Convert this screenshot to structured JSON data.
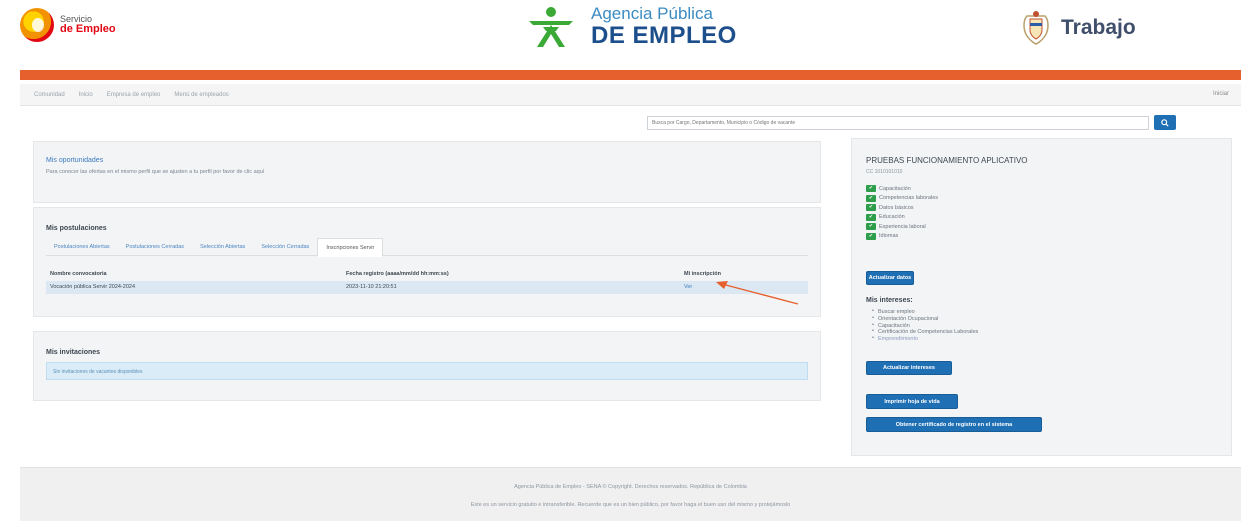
{
  "header": {
    "left_logo_small": "Servicio",
    "left_logo_big": "de Empleo",
    "center_line1": "Agencia Pública",
    "center_line2": "DE EMPLEO",
    "right_logo": "Trabajo"
  },
  "breadcrumb": {
    "items": [
      "Comunidad",
      "Inicio",
      "Empresa de empleo",
      "Menú de empleados"
    ],
    "right": "Iniciar"
  },
  "search": {
    "placeholder": "Busca por Cargo, Departamento, Municipio o Código de vacante"
  },
  "oportunidades": {
    "title": "Mis oportunidades",
    "text": "Para conocer las ofertas en el mismo perfil que se ajusten a tu perfil por favor de clic aquí"
  },
  "postulaciones": {
    "title": "Mis postulaciones",
    "tabs": [
      "Postulaciones Abiertas",
      "Postulaciones Cerradas",
      "Selección Abiertas",
      "Selección Cerradas",
      "Inscripciones Servir"
    ],
    "active_tab": 4,
    "columns": [
      "Nombre convocatoria",
      "Fecha registro (aaaa/mm/dd hh:mm:ss)",
      "Mi inscripción"
    ],
    "rows": [
      {
        "nombre": "Vocación pública Servir 2024-2024",
        "fecha": "2023-11-10 21:20:51",
        "inscripcion": "Ver"
      }
    ]
  },
  "invitaciones": {
    "title": "Mis invitaciones",
    "message": "Sin invitaciones de vacantes disponibles"
  },
  "sidebar": {
    "name": "PRUEBAS FUNCIONAMIENTO APLICATIVO",
    "cc": "CC 1010101010",
    "checks": [
      "Capacitación",
      "Competencias laborales",
      "Datos básicos",
      "Educación",
      "Experiencia laboral",
      "Idiomas"
    ],
    "check_mark": "✔",
    "update_button": "Actualizar datos",
    "interests_title": "Mis intereses:",
    "interests": [
      "Buscar empleo",
      "Orientación Ocupacional",
      "Capacitación",
      "Certificación de Competencias Laborales",
      "Emprendimiento"
    ],
    "interests_button": "Actualizar intereses",
    "cv_button": "Imprimir hoja de vida",
    "cert_button": "Obtener certificado de registro en el sistema"
  },
  "footer": {
    "line1": "Agencia Pública de Empleo - SENA © Copyright. Derechos reservados. República de Colombia",
    "line2": "Este es un servicio gratuito e intransferible. Recuerde que es un bien público, por favor haga el buen uso del mismo y protejámoslo"
  },
  "colors": {
    "accent": "#1f6fb4",
    "orange": "#e6602d",
    "check": "#2e9e4b"
  }
}
